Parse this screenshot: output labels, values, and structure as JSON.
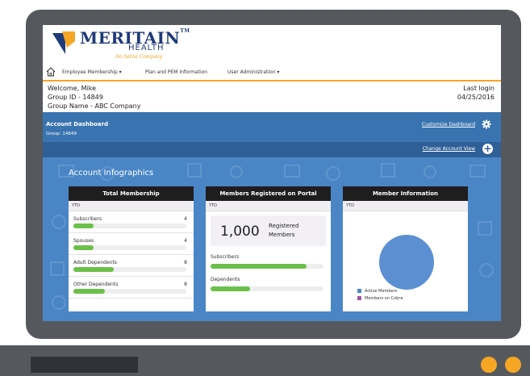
{
  "brand": {
    "name": "MERITAIN",
    "tm": "TM",
    "sub": "HEALTH",
    "tagline": "An Aetna Company"
  },
  "nav": {
    "home_icon": "home-icon",
    "items": [
      "Employee Membership ▾",
      "Plan and PEM Information",
      "User Administration ▾"
    ]
  },
  "user": {
    "welcome": "Welcome, Mike",
    "group_id": "Group ID - 14849",
    "group_name": "Group Name - ABC Company",
    "last_login_label": "Last login",
    "last_login_date": "04/25/2016"
  },
  "dashboard": {
    "title": "Account Dashboard",
    "group": "Group: 14849",
    "customize_label": "Customize Dashboard",
    "change_view_label": "Change Account View"
  },
  "infographics": {
    "title": "Account Infographics",
    "total_membership": {
      "header": "Total Membership",
      "period": "YTD",
      "rows": [
        {
          "label": "Subscribers",
          "count": "4",
          "level": 0.18
        },
        {
          "label": "Spouses",
          "count": "4",
          "level": 0.18
        },
        {
          "label": "Adult Dependents",
          "count": "8",
          "level": 0.36
        },
        {
          "label": "Other Dependents",
          "count": "8",
          "level": 0.28
        }
      ]
    },
    "members_portal": {
      "header": "Members Registered on Portal",
      "period": "YTD",
      "count": "1,000",
      "count_label_1": "Registered",
      "count_label_2": "Members",
      "subscribers_label": "Subscribers",
      "subscribers_level": 0.85,
      "dependents_label": "Dependents",
      "dependents_level": 0.35
    },
    "member_information": {
      "header": "Member Information",
      "period": "YTD",
      "legend": [
        {
          "label": "Active Members",
          "color": "#4a86c6"
        },
        {
          "label": "Members on Cobra",
          "color": "#a0569d"
        }
      ]
    }
  },
  "colors": {
    "accent": "#f5a623",
    "blue": "#3a74b0",
    "green": "#6cc04a"
  }
}
